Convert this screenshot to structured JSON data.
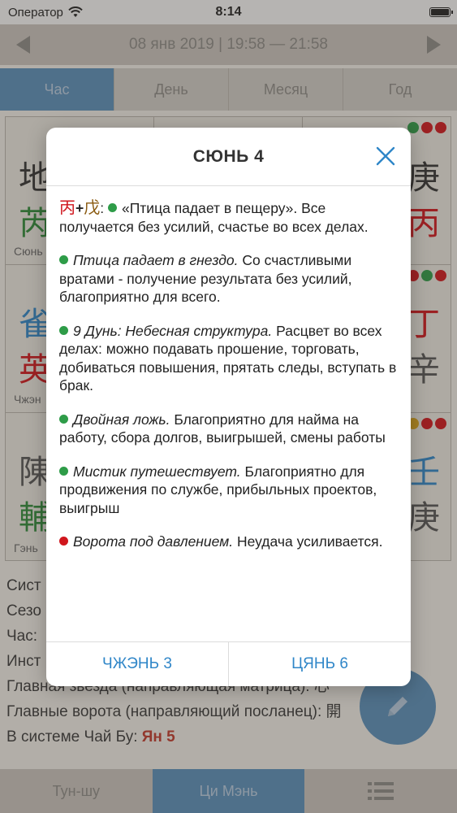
{
  "status_bar": {
    "carrier": "Оператор",
    "time": "8:14"
  },
  "date_bar": {
    "prev_icon": "triangle-left-icon",
    "date": "08 янв 2019  |  19:58 — 21:58",
    "next_icon": "triangle-right-icon"
  },
  "period_tabs": [
    {
      "label": "Час",
      "active": true
    },
    {
      "label": "День",
      "active": false
    },
    {
      "label": "Месяц",
      "active": false
    },
    {
      "label": "Год",
      "active": false
    }
  ],
  "grid": {
    "cells": [
      {
        "top": "地",
        "bottom": "芮",
        "name": "Сюнь"
      },
      {
        "top": "",
        "bottom": "",
        "name": ""
      },
      {
        "top": "庚",
        "bottom": "丙",
        "name": ""
      },
      {
        "top": "雀",
        "bottom": "英",
        "name": "Чжэн"
      },
      {
        "top": "",
        "bottom": "",
        "name": ""
      },
      {
        "top": "丁",
        "bottom": "辛",
        "name": ""
      },
      {
        "top": "陳",
        "bottom": "輔",
        "name": "Гэнь"
      },
      {
        "top": "",
        "bottom": "",
        "name": ""
      },
      {
        "top": "壬",
        "bottom": "庚",
        "name": ""
      }
    ]
  },
  "info_lines": [
    {
      "text": "Сист",
      "value": ""
    },
    {
      "text": "Сезо",
      "value": ""
    },
    {
      "text": "Час:",
      "value": ""
    },
    {
      "text": "Инст",
      "value": ""
    },
    {
      "text": "Главная звезда (направляющая матрица): ",
      "value": "心"
    },
    {
      "text": "Главные ворота (направляющий посланец): ",
      "value": "開"
    },
    {
      "text": "В системе Чай Бу: ",
      "value": "Ян 5"
    }
  ],
  "fab": {
    "icon": "pencil-icon"
  },
  "bottom_tabs": [
    {
      "label": "Тун-шу",
      "active": false
    },
    {
      "label": "Ци Мэнь",
      "active": true
    },
    {
      "label": "",
      "icon": "list-icon",
      "active": false
    }
  ],
  "dialog": {
    "title": "СЮНЬ 4",
    "close_icon": "close-icon",
    "paragraphs": [
      {
        "stem1": "丙",
        "plus": "+",
        "stem2": "戊",
        "sep": ":",
        "dot": "green",
        "name": "",
        "text": "«Птица падает в пещеру». Все получается без усилий, счастье во всех делах."
      },
      {
        "dot": "green",
        "name": "Птица падает в гнездо.",
        "text": "Со счастливыми вратами  -  получение результата без усилий, благоприятно для всего."
      },
      {
        "dot": "green",
        "name": "9 Дунь:  Небесная структура.",
        "text": "Расцвет во всех делах: можно подавать прошение, торговать, добиваться повышения, прятать следы, вступать в брак."
      },
      {
        "dot": "green",
        "name": "Двойная ложь.",
        "text": "Благоприятно для найма на работу, сбора долгов, выигрышей, смены работы"
      },
      {
        "dot": "green",
        "name": "Мистик путешествует.",
        "text": "Благоприятно для продвижения по службе, прибыльных проектов, выигрыш"
      },
      {
        "dot": "red",
        "name": "Ворота под давлением.",
        "text": "Неудача усиливается."
      }
    ],
    "buttons": {
      "left": "ЧЖЭНЬ 3",
      "right": "ЦЯНЬ 6"
    }
  },
  "colors": {
    "accent": "#2f86c8",
    "tab_active": "#5a8fba",
    "good": "#2e9c48",
    "bad": "#d0161d"
  }
}
